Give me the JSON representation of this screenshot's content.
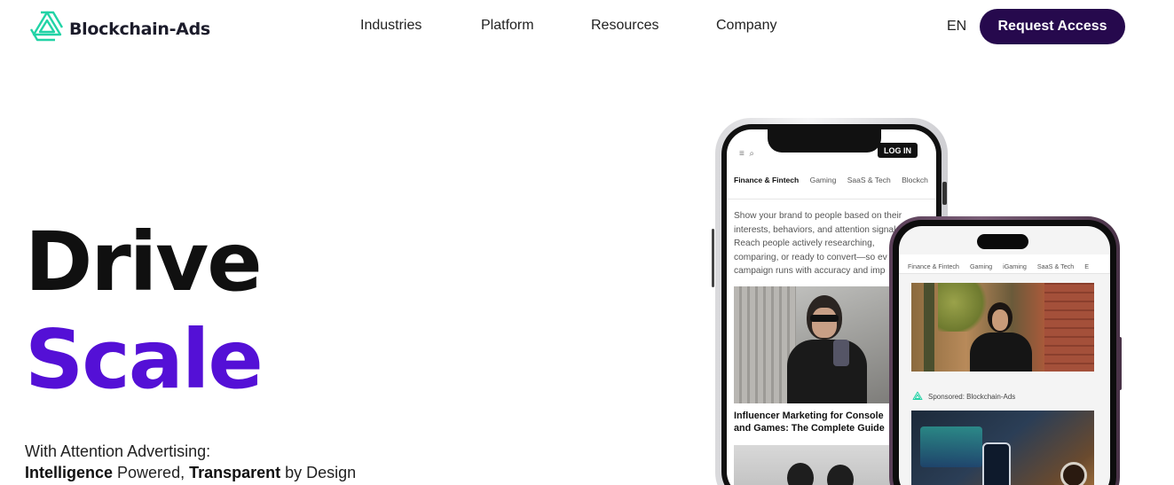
{
  "brand": {
    "name": "Blockchain-Ads",
    "accent_color": "#5410d6",
    "cta_color": "#26094d",
    "logo_color": "#22d3a6"
  },
  "nav": {
    "items": [
      {
        "label": "Industries"
      },
      {
        "label": "Platform"
      },
      {
        "label": "Resources"
      },
      {
        "label": "Company"
      }
    ],
    "lang": "EN",
    "cta": "Request Access"
  },
  "hero": {
    "line1": "Drive",
    "line2": "Scale",
    "sub1": "With Attention Advertising:",
    "sub2_bold1": "Intelligence",
    "sub2_mid": " Powered, ",
    "sub2_bold2": "Transparent",
    "sub2_end": " by Design"
  },
  "phone1": {
    "login": "LOG IN",
    "tabs": [
      "Finance & Fintech",
      "Gaming",
      "SaaS & Tech",
      "Blockch"
    ],
    "text": "Show your brand to people based on their\ninterests, behaviors, and attention signals.\nReach people actively researching,\ncomparing, or ready to convert—so ev\ncampaign runs with accuracy and imp",
    "article_title": "Influencer Marketing for Console and Games: The Complete Guide"
  },
  "phone2": {
    "tabs": [
      "Finance & Fintech",
      "Gaming",
      "iGaming",
      "SaaS & Tech",
      "E"
    ],
    "sponsored": "Sponsored: Blockchain-Ads"
  }
}
